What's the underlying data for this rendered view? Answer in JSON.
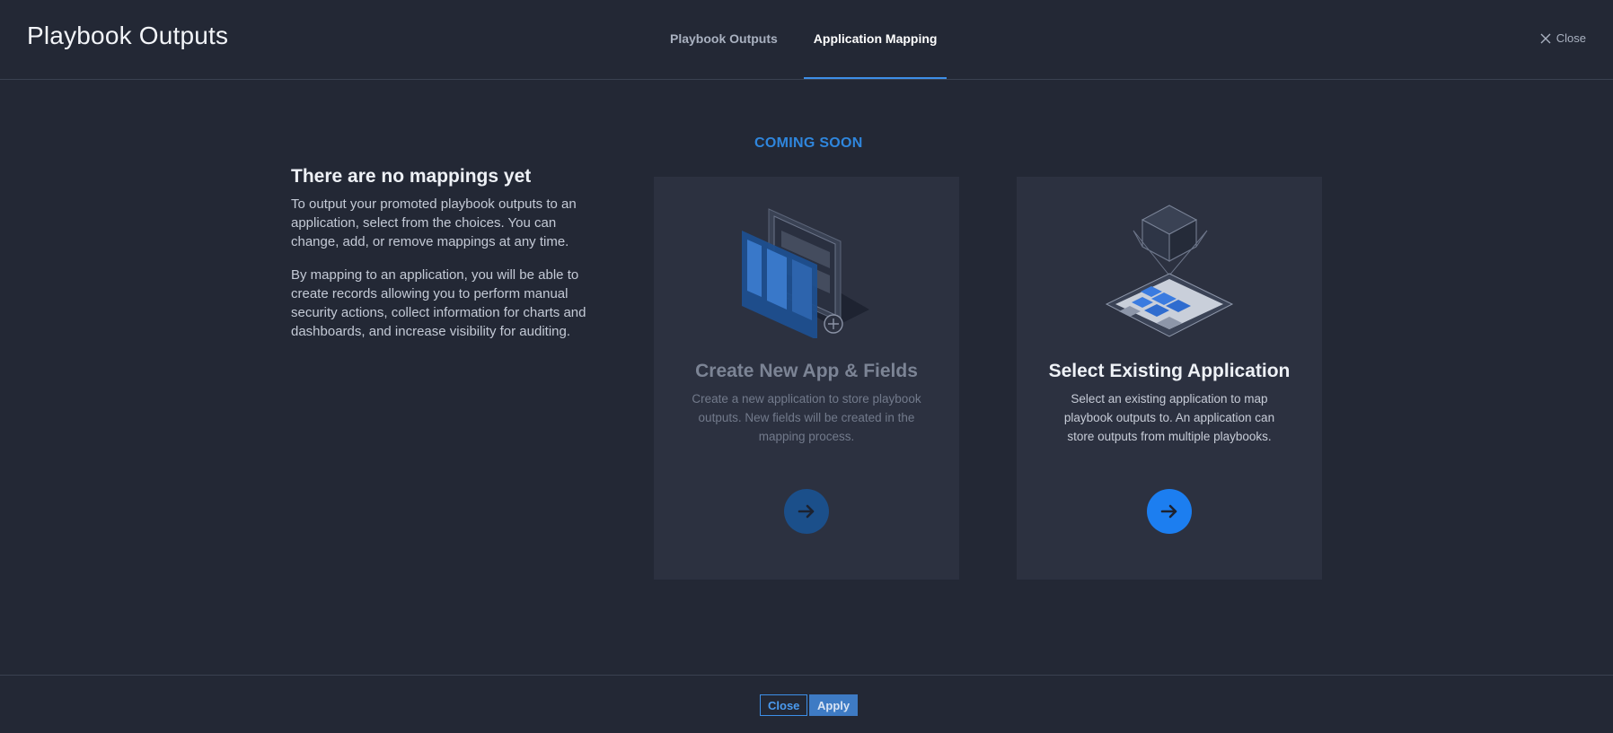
{
  "header": {
    "title": "Playbook Outputs",
    "tabs": [
      {
        "label": "Playbook Outputs",
        "active": false
      },
      {
        "label": "Application Mapping",
        "active": true
      }
    ],
    "close_label": "Close"
  },
  "main": {
    "badge": "COMING SOON",
    "intro": {
      "heading": "There are no mappings yet",
      "paragraph1": "To output your promoted playbook outputs to an application, select from the choices. You can change, add, or remove mappings at any time.",
      "paragraph2": "By mapping to an application, you will be able to create records allowing you to perform manual security actions, collect information for charts and dashboards, and increase visibility for auditing."
    },
    "cards": [
      {
        "title": "Create New App & Fields",
        "description": "Create a new application to store playbook outputs. New fields will be created in the mapping process.",
        "illustration": "new-app-illustration",
        "button_icon": "arrow-right-icon",
        "disabled": true
      },
      {
        "title": "Select Existing Application",
        "description": "Select an existing application to map playbook outputs to. An application can store outputs from multiple playbooks.",
        "illustration": "existing-app-illustration",
        "button_icon": "arrow-right-icon",
        "disabled": false
      }
    ]
  },
  "footer": {
    "close_label": "Close",
    "apply_label": "Apply"
  },
  "colors": {
    "background": "#232835",
    "card": "#2c3140",
    "accent": "#1c7ef0",
    "badge": "#2f86dd"
  }
}
